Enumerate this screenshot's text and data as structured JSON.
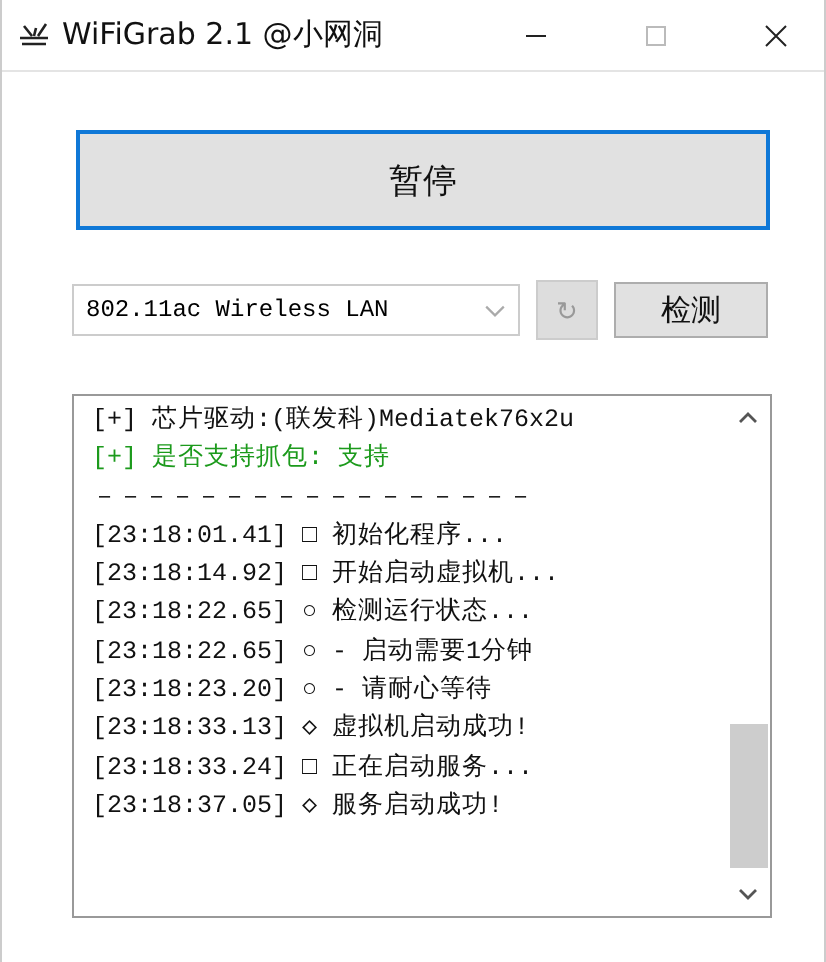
{
  "window": {
    "title": "WiFiGrab 2.1 @小网洞"
  },
  "main_button": {
    "label": "暂停",
    "focused": true
  },
  "adapter": {
    "value": "802.11ac Wireless LAN"
  },
  "refresh_button": {
    "label": "↻",
    "disabled": true
  },
  "detect_button": {
    "label": "检测",
    "disabled": false
  },
  "log": [
    {
      "kind": "plain",
      "text": "[+] 芯片驱动:(联发科)Mediatek76x2u"
    },
    {
      "kind": "success",
      "text": "[+] 是否支持抓包: 支持"
    },
    {
      "kind": "plain",
      "text": "－－－－－－－－－－－－－－－－－"
    },
    {
      "kind": "plain",
      "text": "[23:18:01.41] □ 初始化程序..."
    },
    {
      "kind": "plain",
      "text": "[23:18:14.92] □ 开始启动虚拟机..."
    },
    {
      "kind": "plain",
      "text": "[23:18:22.65] ○ 检测运行状态..."
    },
    {
      "kind": "plain",
      "text": "[23:18:22.65] ○ - 启动需要1分钟"
    },
    {
      "kind": "plain",
      "text": "[23:18:23.20] ○ - 请耐心等待"
    },
    {
      "kind": "plain",
      "text": "[23:18:33.13] ◇ 虚拟机启动成功!"
    },
    {
      "kind": "plain",
      "text": "[23:18:33.24] □ 正在启动服务..."
    },
    {
      "kind": "plain",
      "text": "[23:18:37.05] ◇ 服务启动成功!"
    }
  ]
}
